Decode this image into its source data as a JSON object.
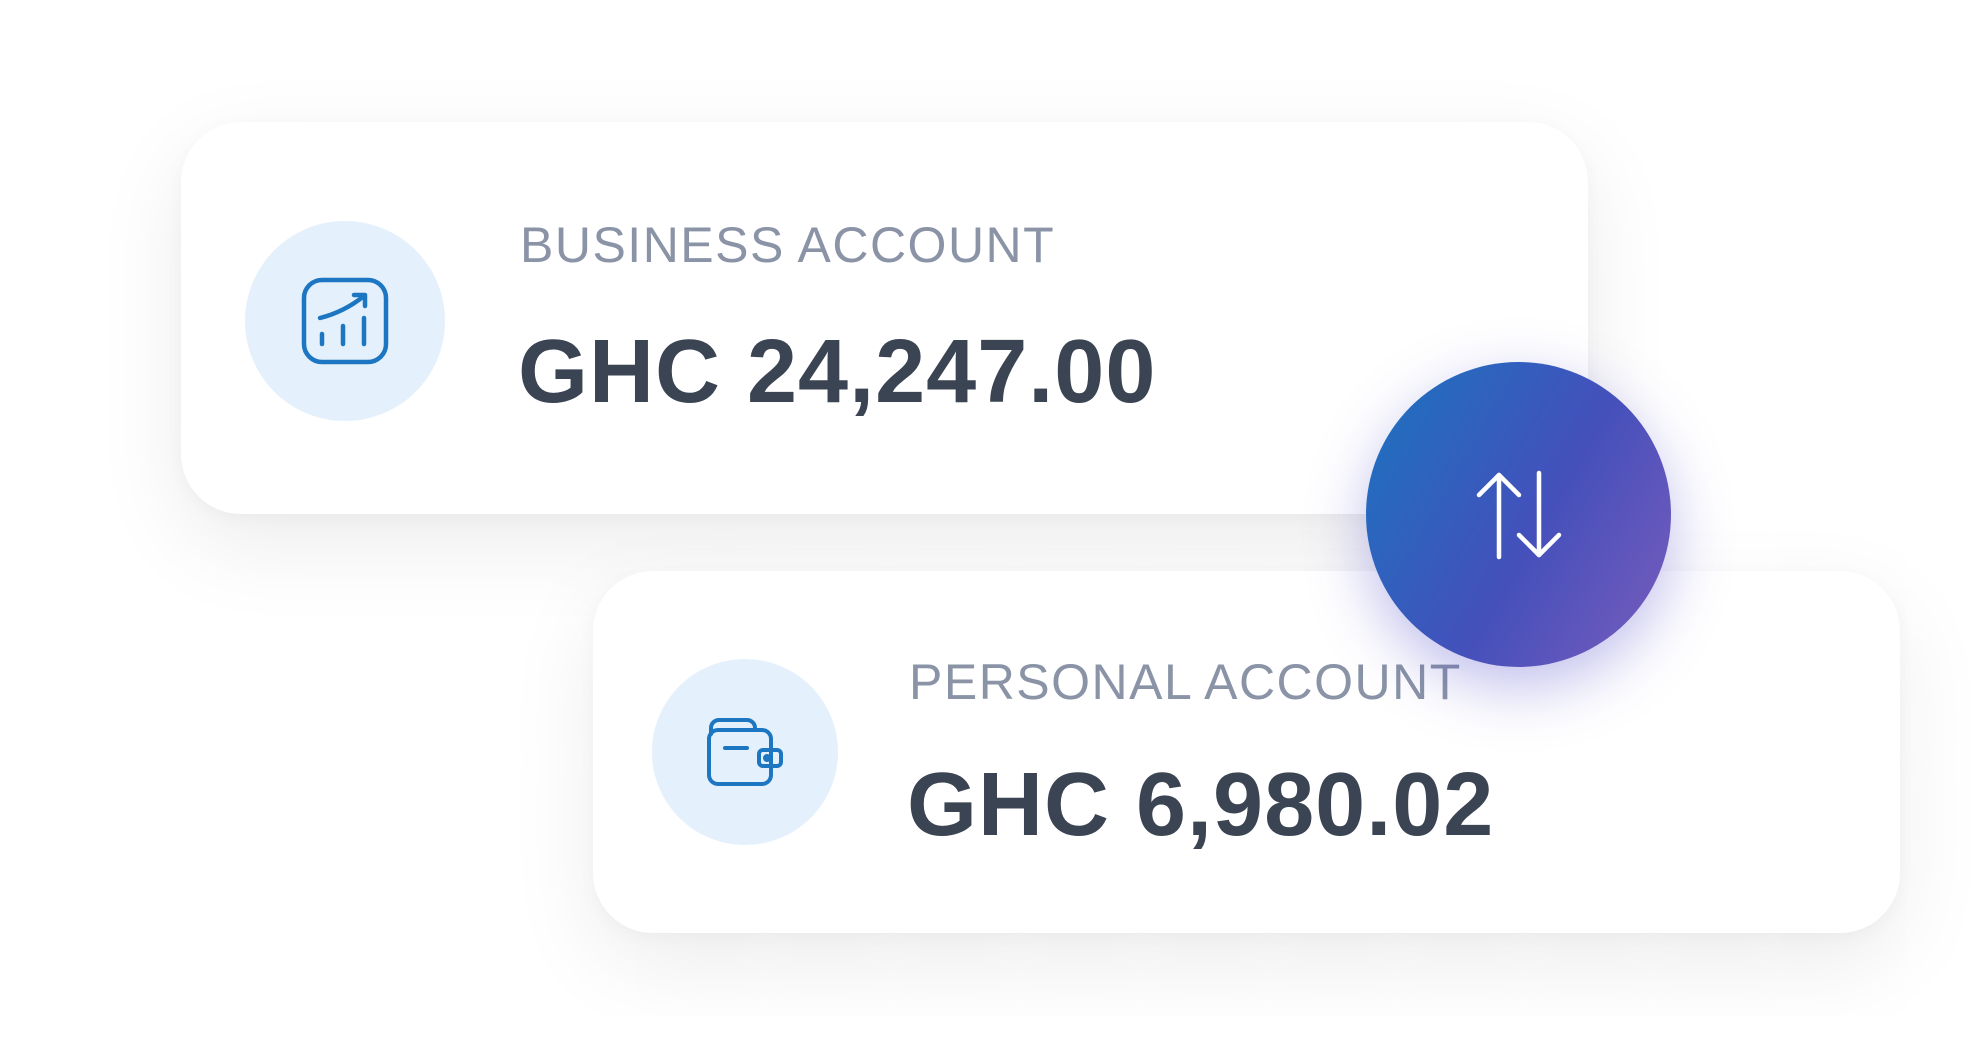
{
  "accounts": [
    {
      "label": "BUSINESS ACCOUNT",
      "amount": "GHC 24,247.00",
      "icon": "chart-trend-icon"
    },
    {
      "label": "PERSONAL ACCOUNT",
      "amount": "GHC 6,980.02",
      "icon": "wallet-icon"
    }
  ],
  "transfer": {
    "icon": "swap-vertical-arrows-icon"
  },
  "colors": {
    "icon_circle_bg": "#e4f0fb",
    "icon_stroke": "#1d76c2",
    "label": "#8a94a6",
    "amount": "#3b4453",
    "gradient_start": "#1a74c0",
    "gradient_mid": "#4450bb",
    "gradient_end": "#7b5cbc"
  }
}
